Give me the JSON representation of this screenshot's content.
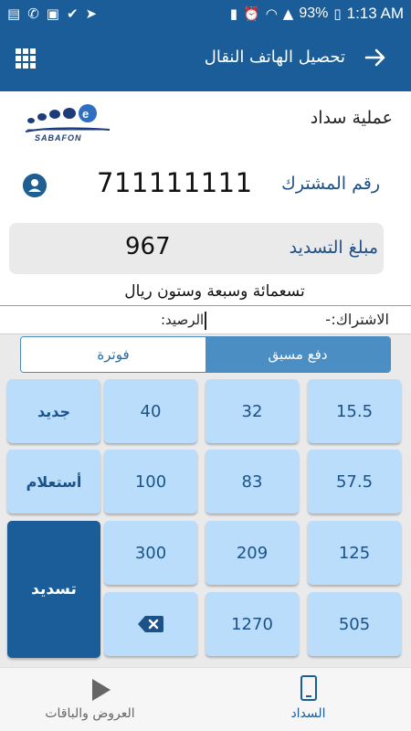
{
  "status_bar": {
    "battery_percent": "93%",
    "time": "1:13 AM"
  },
  "app_bar": {
    "title": "تحصيل الهاتف النقال"
  },
  "header": {
    "operation_label": "عملية سداد",
    "logo_text": "SABAFON"
  },
  "subscriber": {
    "label": "رقم المشترك",
    "number": "711111111"
  },
  "amount": {
    "label": "مبلغ التسديد",
    "value": "967",
    "in_words": "تسعمائة وسبعة وستون ريال"
  },
  "info": {
    "subscription_label": "الاشتراك:",
    "subscription_value": "-",
    "balance_label": "الرصيد:"
  },
  "tabs": {
    "prepaid": "دفع مسبق",
    "bill": "فوترة",
    "active": "prepaid"
  },
  "keypad": {
    "col1": [
      "15.5",
      "57.5",
      "125",
      "505"
    ],
    "col2": [
      "32",
      "83",
      "209",
      "1270"
    ],
    "col3": [
      "40",
      "100",
      "300"
    ],
    "new": "جديد",
    "inquiry": "أستعلام",
    "pay": "تسديد"
  },
  "bottom_nav": {
    "payment": "السداد",
    "offers": "العروض والباقات",
    "active": "payment"
  },
  "colors": {
    "primary": "#1b5d98",
    "key_bg": "#b9ddfb",
    "tab_active": "#4a8ec4"
  }
}
